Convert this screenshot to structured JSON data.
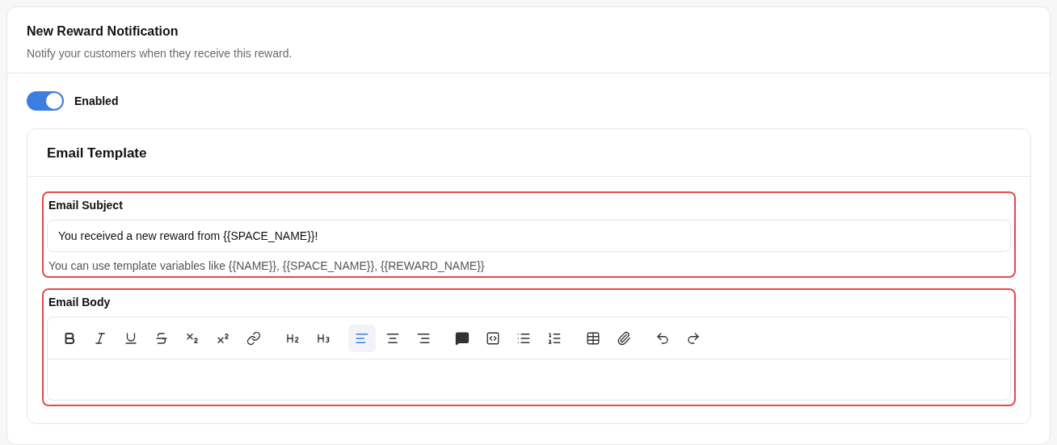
{
  "card": {
    "title": "New Reward Notification",
    "subtitle": "Notify your customers when they receive this reward."
  },
  "toggle": {
    "label": "Enabled",
    "on": true
  },
  "template": {
    "title": "Email Template",
    "subject": {
      "label": "Email Subject",
      "value": "You received a new reward from {{SPACE_NAME}}!",
      "hint": "You can use template variables like {{NAME}}, {{SPACE_NAME}}, {{REWARD_NAME}}",
      "highlighted": true
    },
    "body": {
      "label": "Email Body",
      "highlighted": true,
      "toolbar": [
        [
          {
            "kind": "bold",
            "selected": false
          },
          {
            "kind": "italic",
            "selected": false
          },
          {
            "kind": "underline",
            "selected": false
          },
          {
            "kind": "strike",
            "selected": false
          },
          {
            "kind": "subscript",
            "selected": false
          },
          {
            "kind": "superscript",
            "selected": false
          },
          {
            "kind": "link",
            "selected": false
          }
        ],
        [
          {
            "kind": "h2",
            "selected": false
          },
          {
            "kind": "h3",
            "selected": false
          }
        ],
        [
          {
            "kind": "align-left",
            "selected": true
          },
          {
            "kind": "align-center",
            "selected": false
          },
          {
            "kind": "align-right",
            "selected": false
          }
        ],
        [
          {
            "kind": "comment",
            "selected": false
          },
          {
            "kind": "code",
            "selected": false
          },
          {
            "kind": "bullet-list",
            "selected": false
          },
          {
            "kind": "ordered-list",
            "selected": false
          }
        ],
        [
          {
            "kind": "table",
            "selected": false
          },
          {
            "kind": "attach",
            "selected": false
          }
        ],
        [
          {
            "kind": "undo",
            "selected": false
          },
          {
            "kind": "redo",
            "selected": false
          }
        ]
      ]
    }
  }
}
